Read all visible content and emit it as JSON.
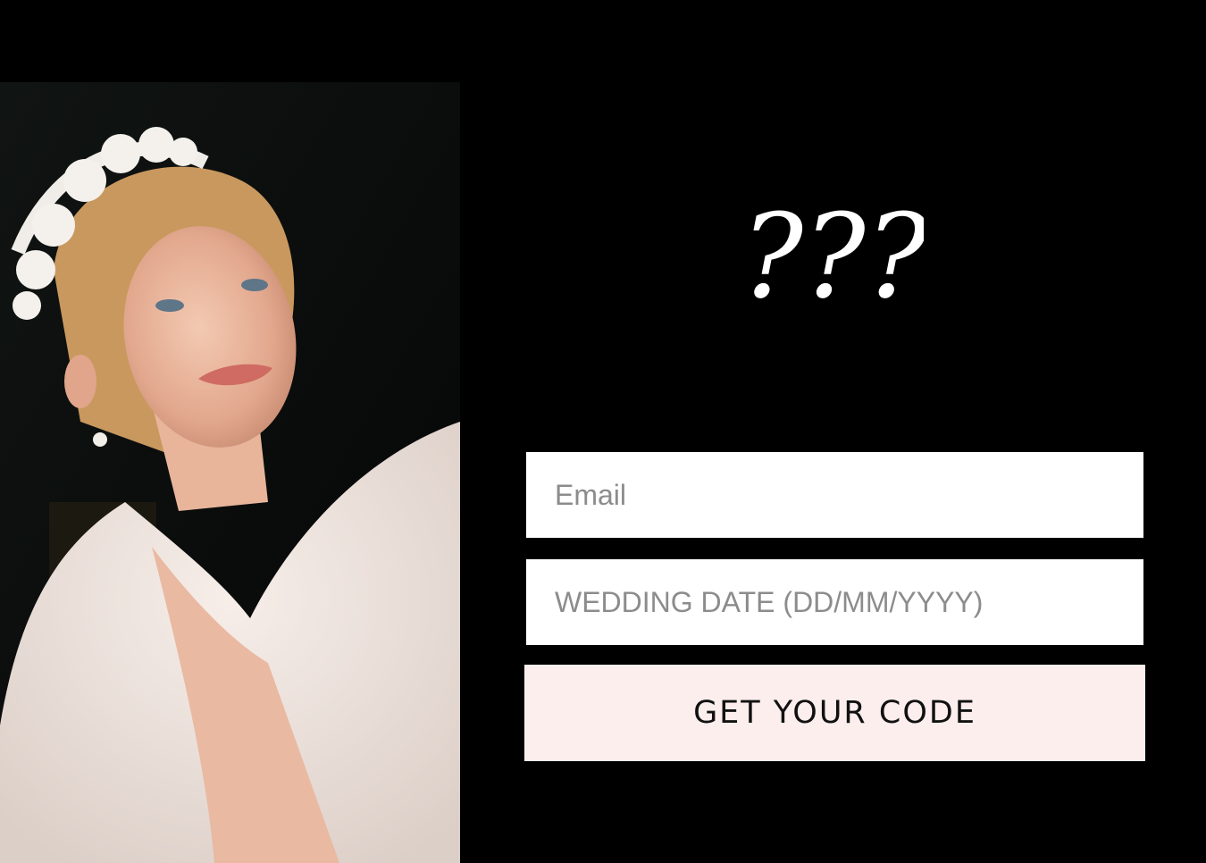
{
  "hero_image": {
    "description_icon": "bride-portrait-photo"
  },
  "heading": {
    "text": "???"
  },
  "form": {
    "email": {
      "value": "",
      "placeholder": "Email"
    },
    "wedding_date": {
      "value": "",
      "placeholder": "WEDDING DATE (DD/MM/YYYY)"
    },
    "submit_label": "GET YOUR CODE"
  },
  "colors": {
    "background": "#000000",
    "field_background": "#ffffff",
    "placeholder": "#8c8c8c",
    "button_background": "#fbeeed",
    "button_text": "#111111"
  }
}
